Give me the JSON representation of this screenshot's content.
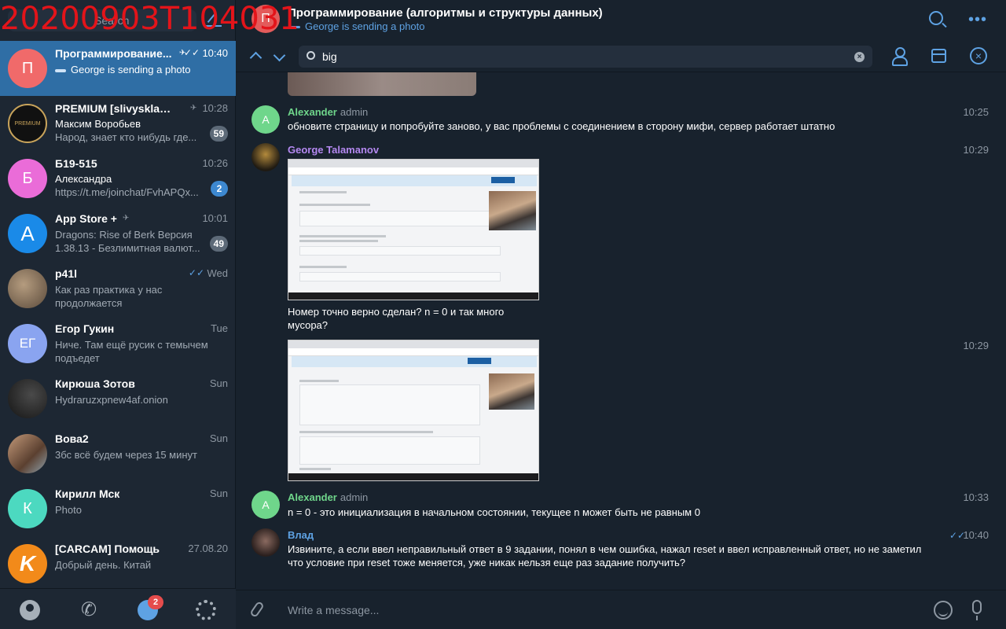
{
  "overlay_timestamp": "20200903T104031",
  "sidebar": {
    "search_placeholder": "Search",
    "chats": [
      {
        "title": "Программирование...",
        "time": "10:40",
        "line1": "",
        "preview": "George is sending a photo",
        "avatar_letter": "П",
        "avatar_color": "#f06a6a",
        "muted": true,
        "read": true,
        "badge": "",
        "active": true,
        "typing": true
      },
      {
        "title": "PREMIUM [slivysklad.c...",
        "time": "10:28",
        "line1": "Максим Воробьев",
        "preview": "Народ, знает кто нибудь где...",
        "avatar_letter": "",
        "avatar_color": "#1b1b1b",
        "muted": true,
        "badge": "59"
      },
      {
        "title": "Б19-515",
        "time": "10:26",
        "line1": "Александра",
        "preview": "https://t.me/joinchat/FvhAPQx...",
        "avatar_letter": "Б",
        "avatar_color": "#ea6cd8",
        "badge": "2",
        "badge_blue": true
      },
      {
        "title": "App Store +",
        "time": "10:01",
        "line1": "",
        "preview": "Dragons: Rise of Berk Версия 1.38.13  - Безлимитная валют...",
        "avatar_letter": "",
        "avatar_color": "#1a8ae8",
        "muted": true,
        "badge": "49"
      },
      {
        "title": "p41l",
        "time": "Wed",
        "line1": "",
        "preview": "Как раз практика у нас продолжается",
        "avatar_letter": "",
        "avatar_color": "#8a7a66",
        "read": true
      },
      {
        "title": "Егор Гукин",
        "time": "Tue",
        "line1": "",
        "preview": "Ниче. Там ещё русик с темычем подъедет",
        "avatar_letter": "ЕГ",
        "avatar_color": "#8aa4f0"
      },
      {
        "title": "Кирюша Зотов",
        "time": "Sun",
        "line1": "",
        "preview": "Hydraruzxpnew4af.onion",
        "avatar_letter": "",
        "avatar_color": "#2a2a2a"
      },
      {
        "title": "Вова2",
        "time": "Sun",
        "line1": "",
        "preview": "3бс всё будем через 15 минут",
        "avatar_letter": "",
        "avatar_color": "#7a5a44"
      },
      {
        "title": "Кирилл Мск",
        "time": "Sun",
        "line1": "",
        "preview": "Photo",
        "avatar_letter": "К",
        "avatar_color": "#4cd9c0"
      },
      {
        "title": "[CARCAM] Помощь",
        "time": "27.08.20",
        "line1": "",
        "preview": "Добрый день. Китай",
        "avatar_letter": "K",
        "avatar_color": "#f28a1a"
      }
    ],
    "chats_unread_badge": "2"
  },
  "header": {
    "title": "Программирование (алгоритмы и структуры данных)",
    "status": "George is sending a photo",
    "avatar_letter": "П"
  },
  "search": {
    "query": "big"
  },
  "messages": [
    {
      "sender": "Alexander",
      "role": "admin",
      "time": "10:25",
      "text": "обновите страницу и попробуйте заново, у вас проблемы с соединением в сторону мифи, сервер работает штатно",
      "avatar_letter": "A",
      "color": "#6fd68b"
    },
    {
      "sender": "George Talamanov",
      "role": "",
      "time": "10:29",
      "text": "Номер точно верно сделан? n = 0 и так много мусора?",
      "color": "#b488f0"
    },
    {
      "time": "10:29"
    },
    {
      "sender": "Alexander",
      "role": "admin",
      "time": "10:33",
      "text": "n = 0 - это инициализация в начальном состоянии, текущее n может быть не равным 0",
      "avatar_letter": "A",
      "color": "#6fd68b"
    },
    {
      "sender": "Влад",
      "role": "",
      "time": "10:40",
      "text": "Извините, а если ввел неправильный ответ в 9 задании, понял в чем ошибка, нажал reset и ввел исправленный ответ, но не заметил что условие при reset тоже меняется, уже никак нельзя еще раз задание получить?",
      "color": "#5ea2e3"
    }
  ],
  "composer": {
    "placeholder": "Write a message..."
  }
}
